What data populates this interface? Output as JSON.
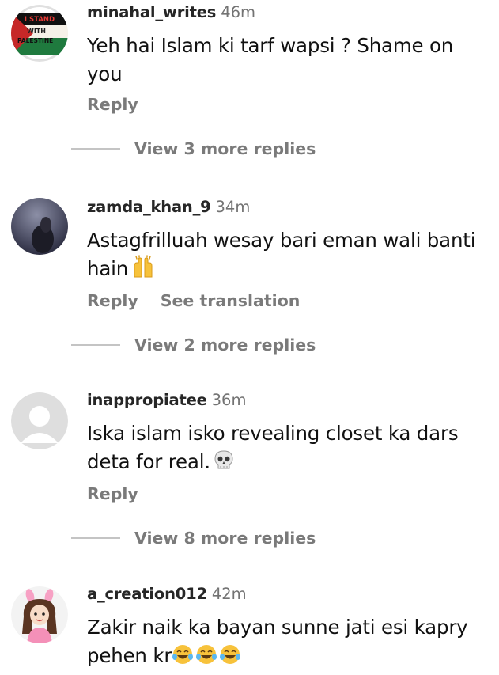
{
  "comments": [
    {
      "username": "minahal_writes",
      "time": "46m",
      "text": "Yeh hai Islam ki tarf wapsi ? Shame on you",
      "reply": "Reply",
      "view_more": "View 3 more replies",
      "avatar_badge": [
        "I STAND",
        "WITH",
        "PALESTINE"
      ]
    },
    {
      "username": "zamda_khan_9",
      "time": "34m",
      "text": "Astagfrilluah wesay bari eman wali banti hain",
      "emoji": "raising-hands",
      "reply": "Reply",
      "see_translation": "See translation",
      "view_more": "View 2 more replies"
    },
    {
      "username": "inappropiatee",
      "time": "36m",
      "text": "Iska islam isko revealing closet ka dars deta for real.",
      "emoji": "skull",
      "reply": "Reply",
      "view_more": "View 8 more replies"
    },
    {
      "username": "a_creation012",
      "time": "42m",
      "text": "Zakir naik ka bayan sunne jati esi kapry pehen kr",
      "emoji": "tears-of-joy"
    }
  ],
  "colors": {
    "secondary_text": "#7a7a7a",
    "divider": "#c4c4c4"
  }
}
